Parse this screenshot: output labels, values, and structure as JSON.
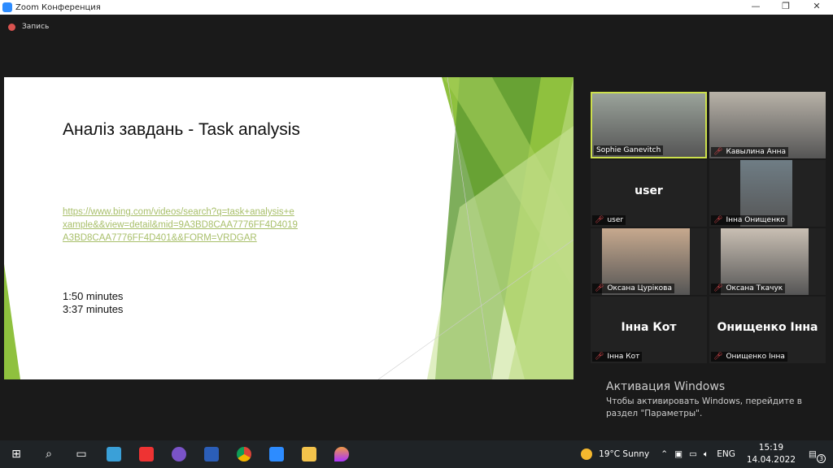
{
  "window": {
    "title": "Zoom Конференция",
    "minimize": "—",
    "restore": "❐",
    "close": "✕"
  },
  "recording": {
    "label": "Запись"
  },
  "slide": {
    "title": "Аналіз завдань - Task analysis",
    "link": "https://www.bing.com/videos/search?q=task+analysis+example&&view=detail&mid=9A3BD8CAA7776FF4D4019A3BD8CAA7776FF4D401&&FORM=VRDGAR",
    "times": [
      "1:50 minutes",
      "3:37 minutes"
    ]
  },
  "participants": [
    {
      "name": "Sophie Ganevitch",
      "video": true,
      "muted": false,
      "active": true,
      "color": "#9aa39a"
    },
    {
      "name": "Кавылина Анна",
      "video": true,
      "muted": true,
      "color": "#b8b2a8"
    },
    {
      "name": "user",
      "video": false,
      "muted": true
    },
    {
      "name": "Інна Онищенко",
      "video": true,
      "muted": true,
      "photo": true,
      "color": "#6f7d85"
    },
    {
      "name": "Оксана Цурікова",
      "video": true,
      "muted": true,
      "photo": true,
      "color": "#c7a98e"
    },
    {
      "name": "Оксана Ткачук",
      "video": true,
      "muted": true,
      "photo": true,
      "color": "#c9bfb3"
    },
    {
      "name": "Інна Кот",
      "video": false,
      "muted": true
    },
    {
      "name": "Онищенко Інна",
      "video": false,
      "muted": true
    }
  ],
  "activation": {
    "title": "Активация Windows",
    "text": "Чтобы активировать Windows, перейдите в раздел \"Параметры\"."
  },
  "taskbar": {
    "weather": "19°C  Sunny",
    "lang": "ENG",
    "time": "15:19",
    "date": "14.04.2022",
    "notifications": "3"
  }
}
